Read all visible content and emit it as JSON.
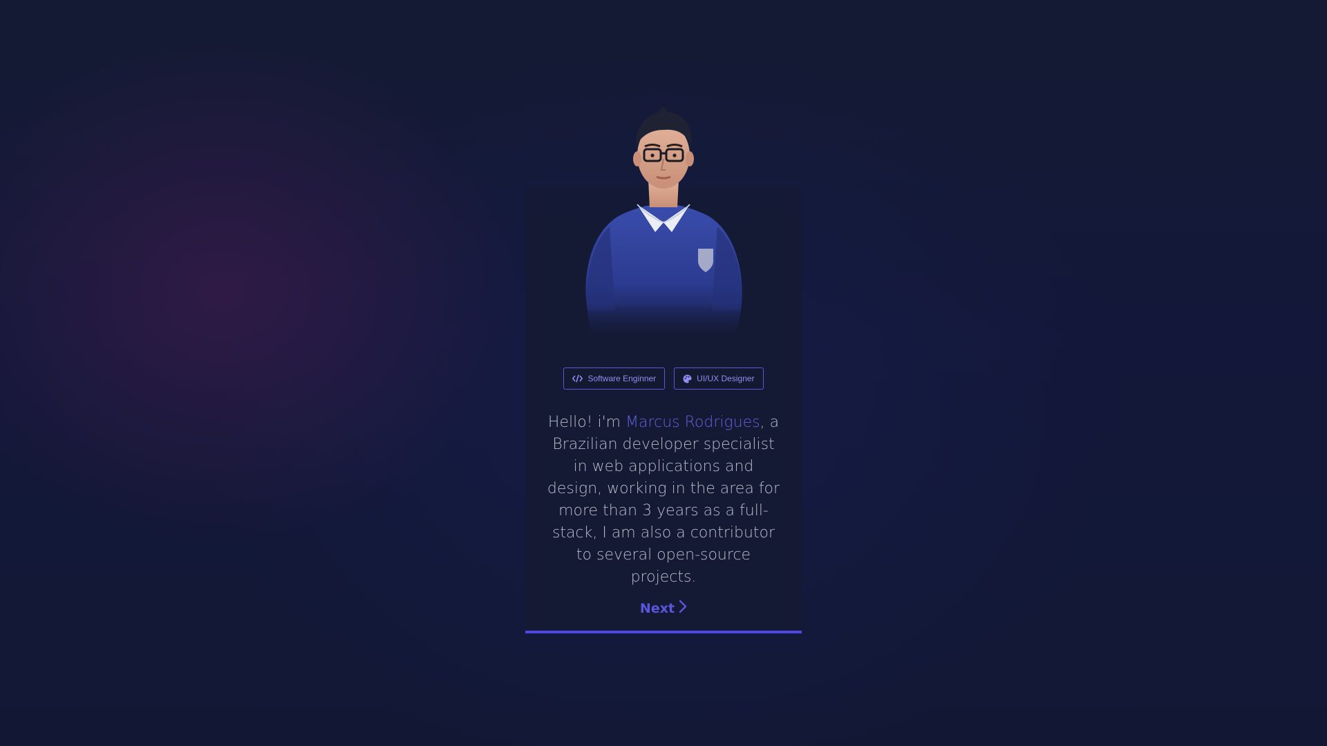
{
  "profile": {
    "tags": [
      {
        "label": "Software Enginner",
        "icon": "code-icon"
      },
      {
        "label": "UI/UX Designer",
        "icon": "palette-icon"
      }
    ],
    "bio": {
      "prefix": "Hello! i'm ",
      "name": "Marcus Rodrigues",
      "suffix": ", a Brazilian developer specialist in web applications and design, working in the area for more than 3 years as a full-stack, I am also a contributor to several open-source projects."
    },
    "next_label": "Next",
    "next_icon": "chevron-right-icon",
    "avatar": "avatar-3d-character"
  },
  "colors": {
    "accent": "#4f46e5",
    "name_highlight": "#6160dc",
    "text": "#b8bccb",
    "background": "#141a33"
  }
}
